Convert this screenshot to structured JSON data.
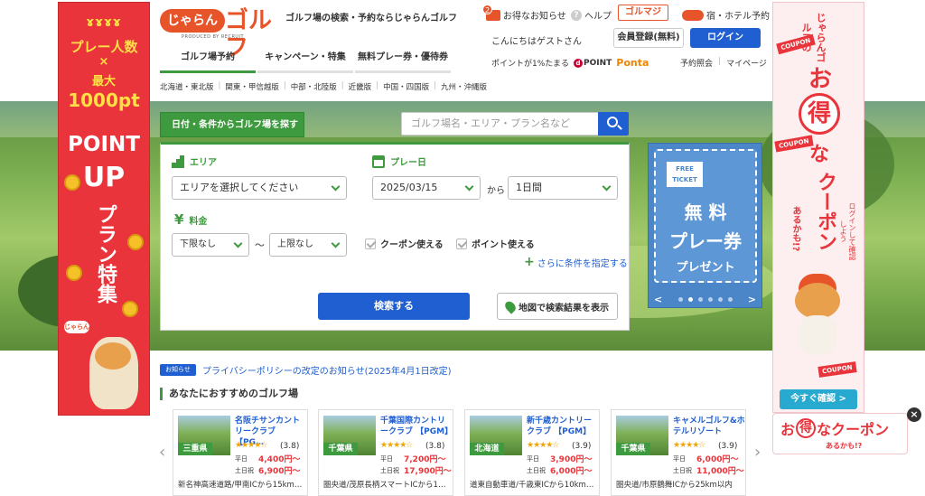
{
  "header": {
    "logo_kana": "じゃらん",
    "logo_golf": "ゴルフ",
    "logo_produced": "PRODUCED BY RECRUIT",
    "tagline": "ゴルフ場の検索・予約ならじゃらんゴルフ",
    "mail_count": "2",
    "deals_label": "お得なお知らせ",
    "help_label": "ヘルプ",
    "golmaji_label": "ゴルマジ",
    "hotel_label": "宿・ホテル予約",
    "greeting": "こんにちはゲストさん",
    "register_label": "会員登録(無料)",
    "login_label": "ログイン",
    "points_text": "ポイントが1%たまる",
    "dpoint_label": "POINT",
    "ponta_label": "Ponta",
    "reservations_link": "予約照会",
    "mypage_link": "マイページ"
  },
  "main_tabs": [
    {
      "label": "ゴルフ場予約"
    },
    {
      "label": "キャンペーン・特集"
    },
    {
      "label": "無料プレー券・優待券"
    }
  ],
  "regions": [
    "北海道・東北版",
    "関東・甲信越版",
    "中部・北陸版",
    "近畿版",
    "中国・四国版",
    "九州・沖縄版"
  ],
  "search": {
    "tab_label": "日付・条件からゴルフ場を探す",
    "keyword_placeholder": "ゴルフ場名・エリア・プラン名など",
    "area_label": "エリア",
    "area_value": "エリアを選択してください",
    "date_label": "プレー日",
    "date_value": "2025/03/15",
    "from_label": "から",
    "duration_value": "1日間",
    "price_label": "料金",
    "price_min": "下限なし",
    "price_sep": "〜",
    "price_max": "上限なし",
    "coupon_check": "クーポン使える",
    "point_check": "ポイント使える",
    "more_conditions": "さらに条件を指定する",
    "search_button": "検索する",
    "map_button": "地図で検索結果を表示"
  },
  "left_banner": {
    "line1": "プレー人数",
    "line2": "×",
    "line3": "最大",
    "line4": "1000pt",
    "line5": "POINT",
    "line6": "UP",
    "line7": "プラン特集",
    "tag": "じゃらん"
  },
  "right_banner": {
    "top": "じゃらんゴルフの",
    "o": "お",
    "toku": "得",
    "na": "な",
    "coupon": "クーポン",
    "aru": "あるかも!?",
    "login_note": "ログインして確認しよう",
    "tag1": "COUPON",
    "tag2": "COUPON",
    "tag3": "COUPON",
    "button": "今すぐ確認 >"
  },
  "float_coupon": {
    "o": "お",
    "toku": "得",
    "rest": "なクーポン",
    "sub": "あるかも!?",
    "close": "×"
  },
  "free_banner": {
    "stamp": "FREE TICKET",
    "line1": "無 料",
    "line2": "プレー券",
    "line3": "プレゼント",
    "prev": "<",
    "next": ">"
  },
  "notice": {
    "badge": "お知らせ",
    "text": "プライバシーポリシーの改定のお知らせ(2025年4月1日改定)"
  },
  "recommend_title": "あなたにおすすめのゴルフ場",
  "courses": [
    {
      "name": "名阪チサンカントリークラブ 【PG…",
      "pref": "三重県",
      "stars": "★★★★☆",
      "rating": "(3.8)",
      "weekday_label": "平日",
      "weekday_price": "4,400円〜",
      "holiday_label": "土日祝",
      "holiday_price": "6,900円〜",
      "access": "新名神高速道路/甲南ICから15km…"
    },
    {
      "name": "千葉国際カントリークラブ 【PGM】",
      "pref": "千葉県",
      "stars": "★★★★☆",
      "rating": "(3.8)",
      "weekday_label": "平日",
      "weekday_price": "7,200円〜",
      "holiday_label": "土日祝",
      "holiday_price": "17,900円〜",
      "access": "圏央道/茂原長柄スマートICから1…"
    },
    {
      "name": "新千歳カントリークラブ 【PGM】",
      "pref": "北海道",
      "stars": "★★★★☆",
      "rating": "(3.9)",
      "weekday_label": "平日",
      "weekday_price": "3,900円〜",
      "holiday_label": "土日祝",
      "holiday_price": "6,000円〜",
      "access": "道東自動車道/千歳東ICから10km…"
    },
    {
      "name": "キャメルゴルフ&ホテルリゾート",
      "pref": "千葉県",
      "stars": "★★★★☆",
      "rating": "(3.9)",
      "weekday_label": "平日",
      "weekday_price": "6,000円〜",
      "holiday_label": "土日祝",
      "holiday_price": "11,000円〜",
      "access": "圏央道/市原鶴舞ICから25km以内"
    }
  ],
  "carousel": {
    "prev": "‹",
    "next": "›"
  },
  "colors": {
    "brand": "#e8542a",
    "green": "#3e9a3e",
    "blue": "#1f5fd1",
    "red": "#e8343a"
  }
}
